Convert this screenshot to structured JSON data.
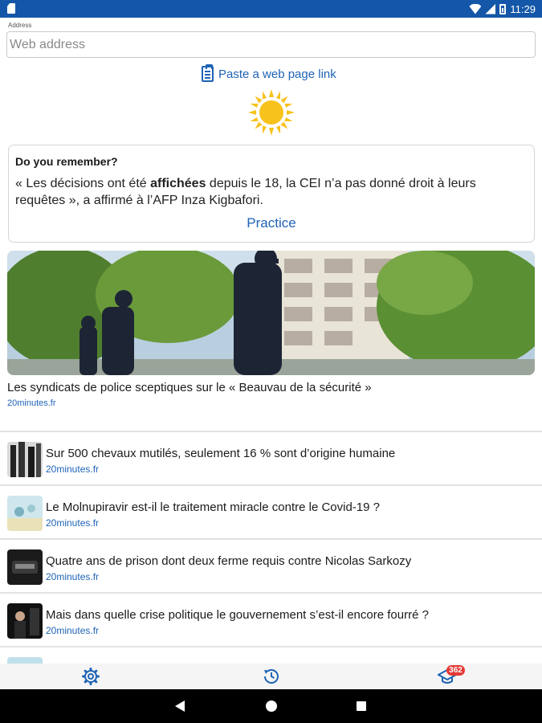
{
  "status_bar": {
    "time": "11:29"
  },
  "address": {
    "label": "Address",
    "placeholder": "Web address"
  },
  "paste_link": {
    "label": "Paste a web page link",
    "icon": "clipboard-icon"
  },
  "weather": {
    "icon": "sun-icon",
    "color": "#f7c21b"
  },
  "remember": {
    "heading": "Do you remember?",
    "quote_before": "« Les décisions ont été ",
    "quote_bold": "affichées",
    "quote_after": " depuis le 18, la CEI n’a pas donné droit à leurs requêtes », a affirmé à l’AFP Inza Kigbafori.",
    "practice_label": "Practice"
  },
  "featured": {
    "title": "Les syndicats de police sceptiques sur le « Beauvau de la sécurité »",
    "source": "20minutes.fr"
  },
  "articles": [
    {
      "title": "Sur 500 chevaux mutilés, seulement 16 % sont d’origine humaine",
      "source": "20minutes.fr"
    },
    {
      "title": "Le Molnupiravir est-il le traitement miracle contre le Covid-19 ?",
      "source": "20minutes.fr"
    },
    {
      "title": "Quatre ans de prison dont deux ferme requis contre Nicolas Sarkozy",
      "source": "20minutes.fr"
    },
    {
      "title": "Mais dans quelle crise politique le gouvernement s’est-il encore fourré ?",
      "source": "20minutes.fr"
    }
  ],
  "bottom_bar": {
    "settings_icon": "gear-icon",
    "history_icon": "history-icon",
    "learn_icon": "graduation-cap-icon",
    "badge_count": "362"
  },
  "colors": {
    "accent": "#1f63b5",
    "status_bar": "#1457a8",
    "badge": "#e53935"
  }
}
